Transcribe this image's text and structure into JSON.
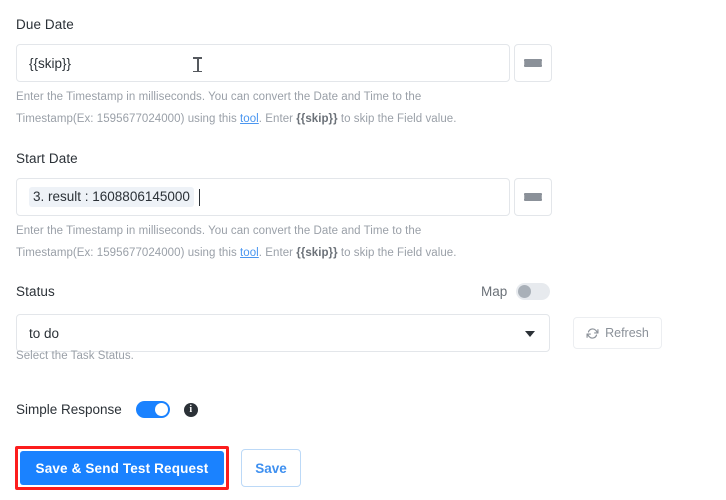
{
  "theme": {
    "accent": "#1a82ff",
    "link": "#4a96f0",
    "highlight_border": "#fc1d1d",
    "token_bg": "#eef2f7",
    "help_text": "#9aa0a8",
    "border": "#e3e6ea"
  },
  "fields": {
    "due_date": {
      "label": "Due Date",
      "value": "{{skip}}",
      "placeholder": "",
      "menu_icon": "hamburger-icon",
      "help": {
        "line1": "Enter the Timestamp in milliseconds. You can convert the Date and Time to the",
        "line2_a": "Timestamp(Ex: 1595677024000) using this ",
        "link": "tool",
        "line2_b": ". Enter ",
        "bold": "{{skip}}",
        "line2_c": " to skip the Field value."
      }
    },
    "start_date": {
      "label": "Start Date",
      "token": "3. result : 1608806145000",
      "placeholder": "",
      "menu_icon": "hamburger-icon",
      "help": {
        "line1": "Enter the Timestamp in milliseconds. You can convert the Date and Time to the",
        "line2_a": "Timestamp(Ex: 1595677024000) using this ",
        "link": "tool",
        "line2_b": ". Enter ",
        "bold": "{{skip}}",
        "line2_c": " to skip the Field value."
      }
    },
    "status": {
      "label": "Status",
      "map_label": "Map",
      "map_enabled": false,
      "selected": "to do",
      "options": [
        "to do"
      ],
      "help": "Select the Task Status.",
      "refresh_label": "Refresh",
      "refresh_icon": "refresh-icon"
    }
  },
  "simple_response": {
    "label": "Simple Response",
    "enabled": true,
    "info_icon": "info-icon",
    "info_glyph": "i"
  },
  "footer": {
    "primary_label": "Save & Send Test Request",
    "secondary_label": "Save"
  },
  "cursor": {
    "type": "text-ibeam-cursor"
  }
}
